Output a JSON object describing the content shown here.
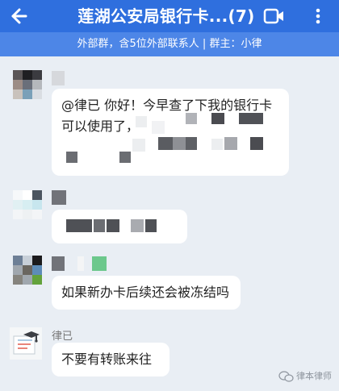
{
  "header": {
    "title": "莲湖公安局银行卡...(7)"
  },
  "subheader": {
    "text": "外部群，含5位外部联系人 | 群主：小律"
  },
  "messages": [
    {
      "text": "@律已 你好！今早查了下我的银行卡"
    },
    {
      "text": "可以使用了，"
    },
    {
      "text": "如果新办卡后续还会被冻结吗"
    },
    {
      "sender": "律已",
      "text": "不要有转账来往"
    }
  ],
  "watermark": {
    "text": "律本律师"
  },
  "icons": {
    "back": "back-arrow-icon",
    "video": "video-call-icon",
    "menu": "more-menu-icon",
    "watermark": "wechat-logo-icon"
  }
}
